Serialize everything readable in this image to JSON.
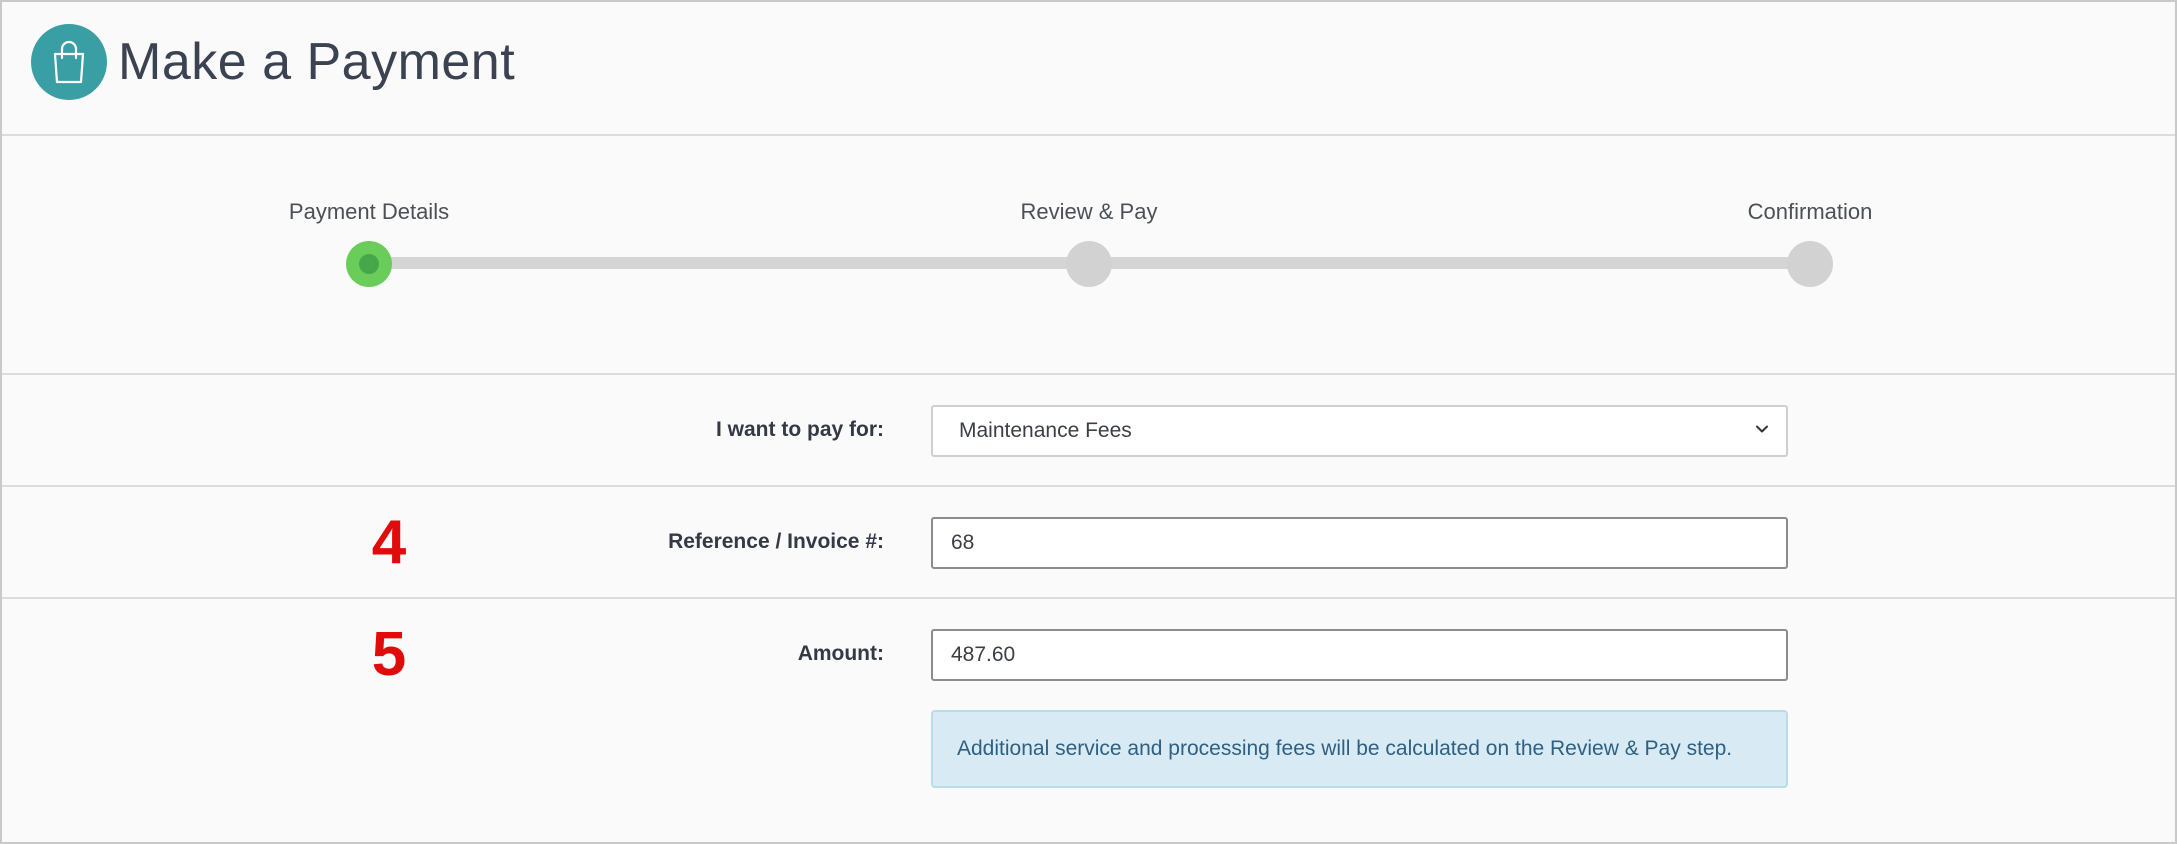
{
  "header": {
    "title": "Make a Payment",
    "logo_icon": "shopping-bag-icon",
    "logo_color": "#3a9ea5"
  },
  "stepper": {
    "steps": [
      {
        "label": "Payment Details",
        "state": "active"
      },
      {
        "label": "Review & Pay",
        "state": "inactive"
      },
      {
        "label": "Confirmation",
        "state": "inactive"
      }
    ],
    "active_color": "#6acd5a",
    "inactive_color": "#d2d2d2"
  },
  "form": {
    "pay_for": {
      "label": "I want to pay for:",
      "selected": "Maintenance Fees"
    },
    "reference": {
      "label": "Reference / Invoice #:",
      "value": "68"
    },
    "amount": {
      "label": "Amount:",
      "value": "487.60"
    },
    "notice": "Additional service and processing fees will be calculated on the Review & Pay step."
  },
  "annotations": {
    "marker_4": "4",
    "marker_5": "5",
    "marker_color": "#e00b0b"
  }
}
